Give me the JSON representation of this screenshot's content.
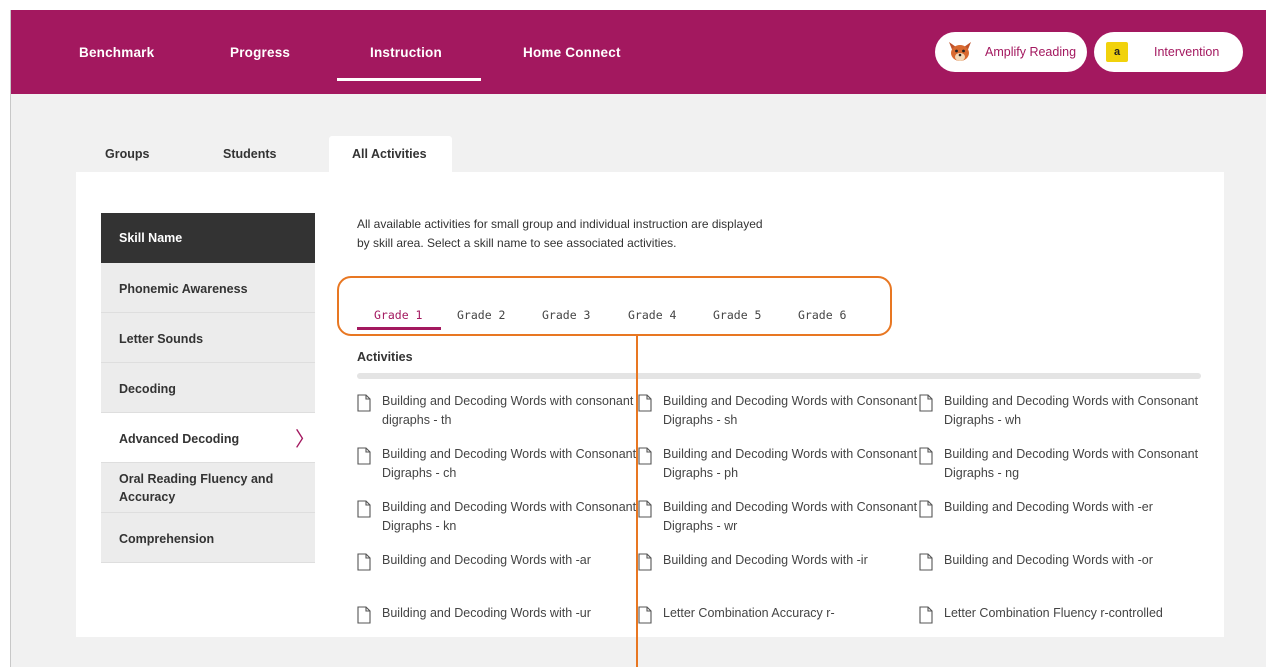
{
  "nav": {
    "items": [
      "Benchmark",
      "Progress",
      "Instruction",
      "Home Connect"
    ],
    "active": "Instruction",
    "amplify_label": "Amplify Reading",
    "intervention_badge": "a",
    "intervention_label": "Intervention"
  },
  "tabs": [
    "Groups",
    "Students",
    "All Activities"
  ],
  "skills": {
    "header": "Skill Name",
    "items": [
      "Phonemic Awareness",
      "Letter Sounds",
      "Decoding",
      "Advanced Decoding",
      "Oral Reading Fluency and Accuracy",
      "Comprehension"
    ],
    "active": "Advanced Decoding"
  },
  "intro": "All available activities for small group and individual instruction are displayed by skill area. Select a skill name to see associated activities.",
  "grades": [
    "Grade 1",
    "Grade 2",
    "Grade 3",
    "Grade 4",
    "Grade 5",
    "Grade 6"
  ],
  "activities_label": "Activities",
  "activities": [
    "Building and Decoding Words with consonant digraphs - th",
    "Building and Decoding Words with Consonant Digraphs - sh",
    "Building and Decoding Words with Consonant Digraphs - wh",
    "Building and Decoding Words with Consonant Digraphs - ch",
    "Building and Decoding Words with Consonant Digraphs - ph",
    "Building and Decoding Words with Consonant Digraphs - ng",
    "Building and Decoding Words with Consonant Digraphs - kn",
    "Building and Decoding Words with Consonant Digraphs - wr",
    "Building and Decoding Words with -er",
    "Building and Decoding Words with -ar",
    "Building and Decoding Words with -ir",
    "Building and Decoding Words with -or",
    "Building and Decoding Words with -ur",
    "Letter Combination Accuracy r-",
    "Letter Combination Fluency r-controlled"
  ],
  "colors": {
    "brand": "#a3185f",
    "callout": "#e87722",
    "badge": "#f1d20c"
  }
}
